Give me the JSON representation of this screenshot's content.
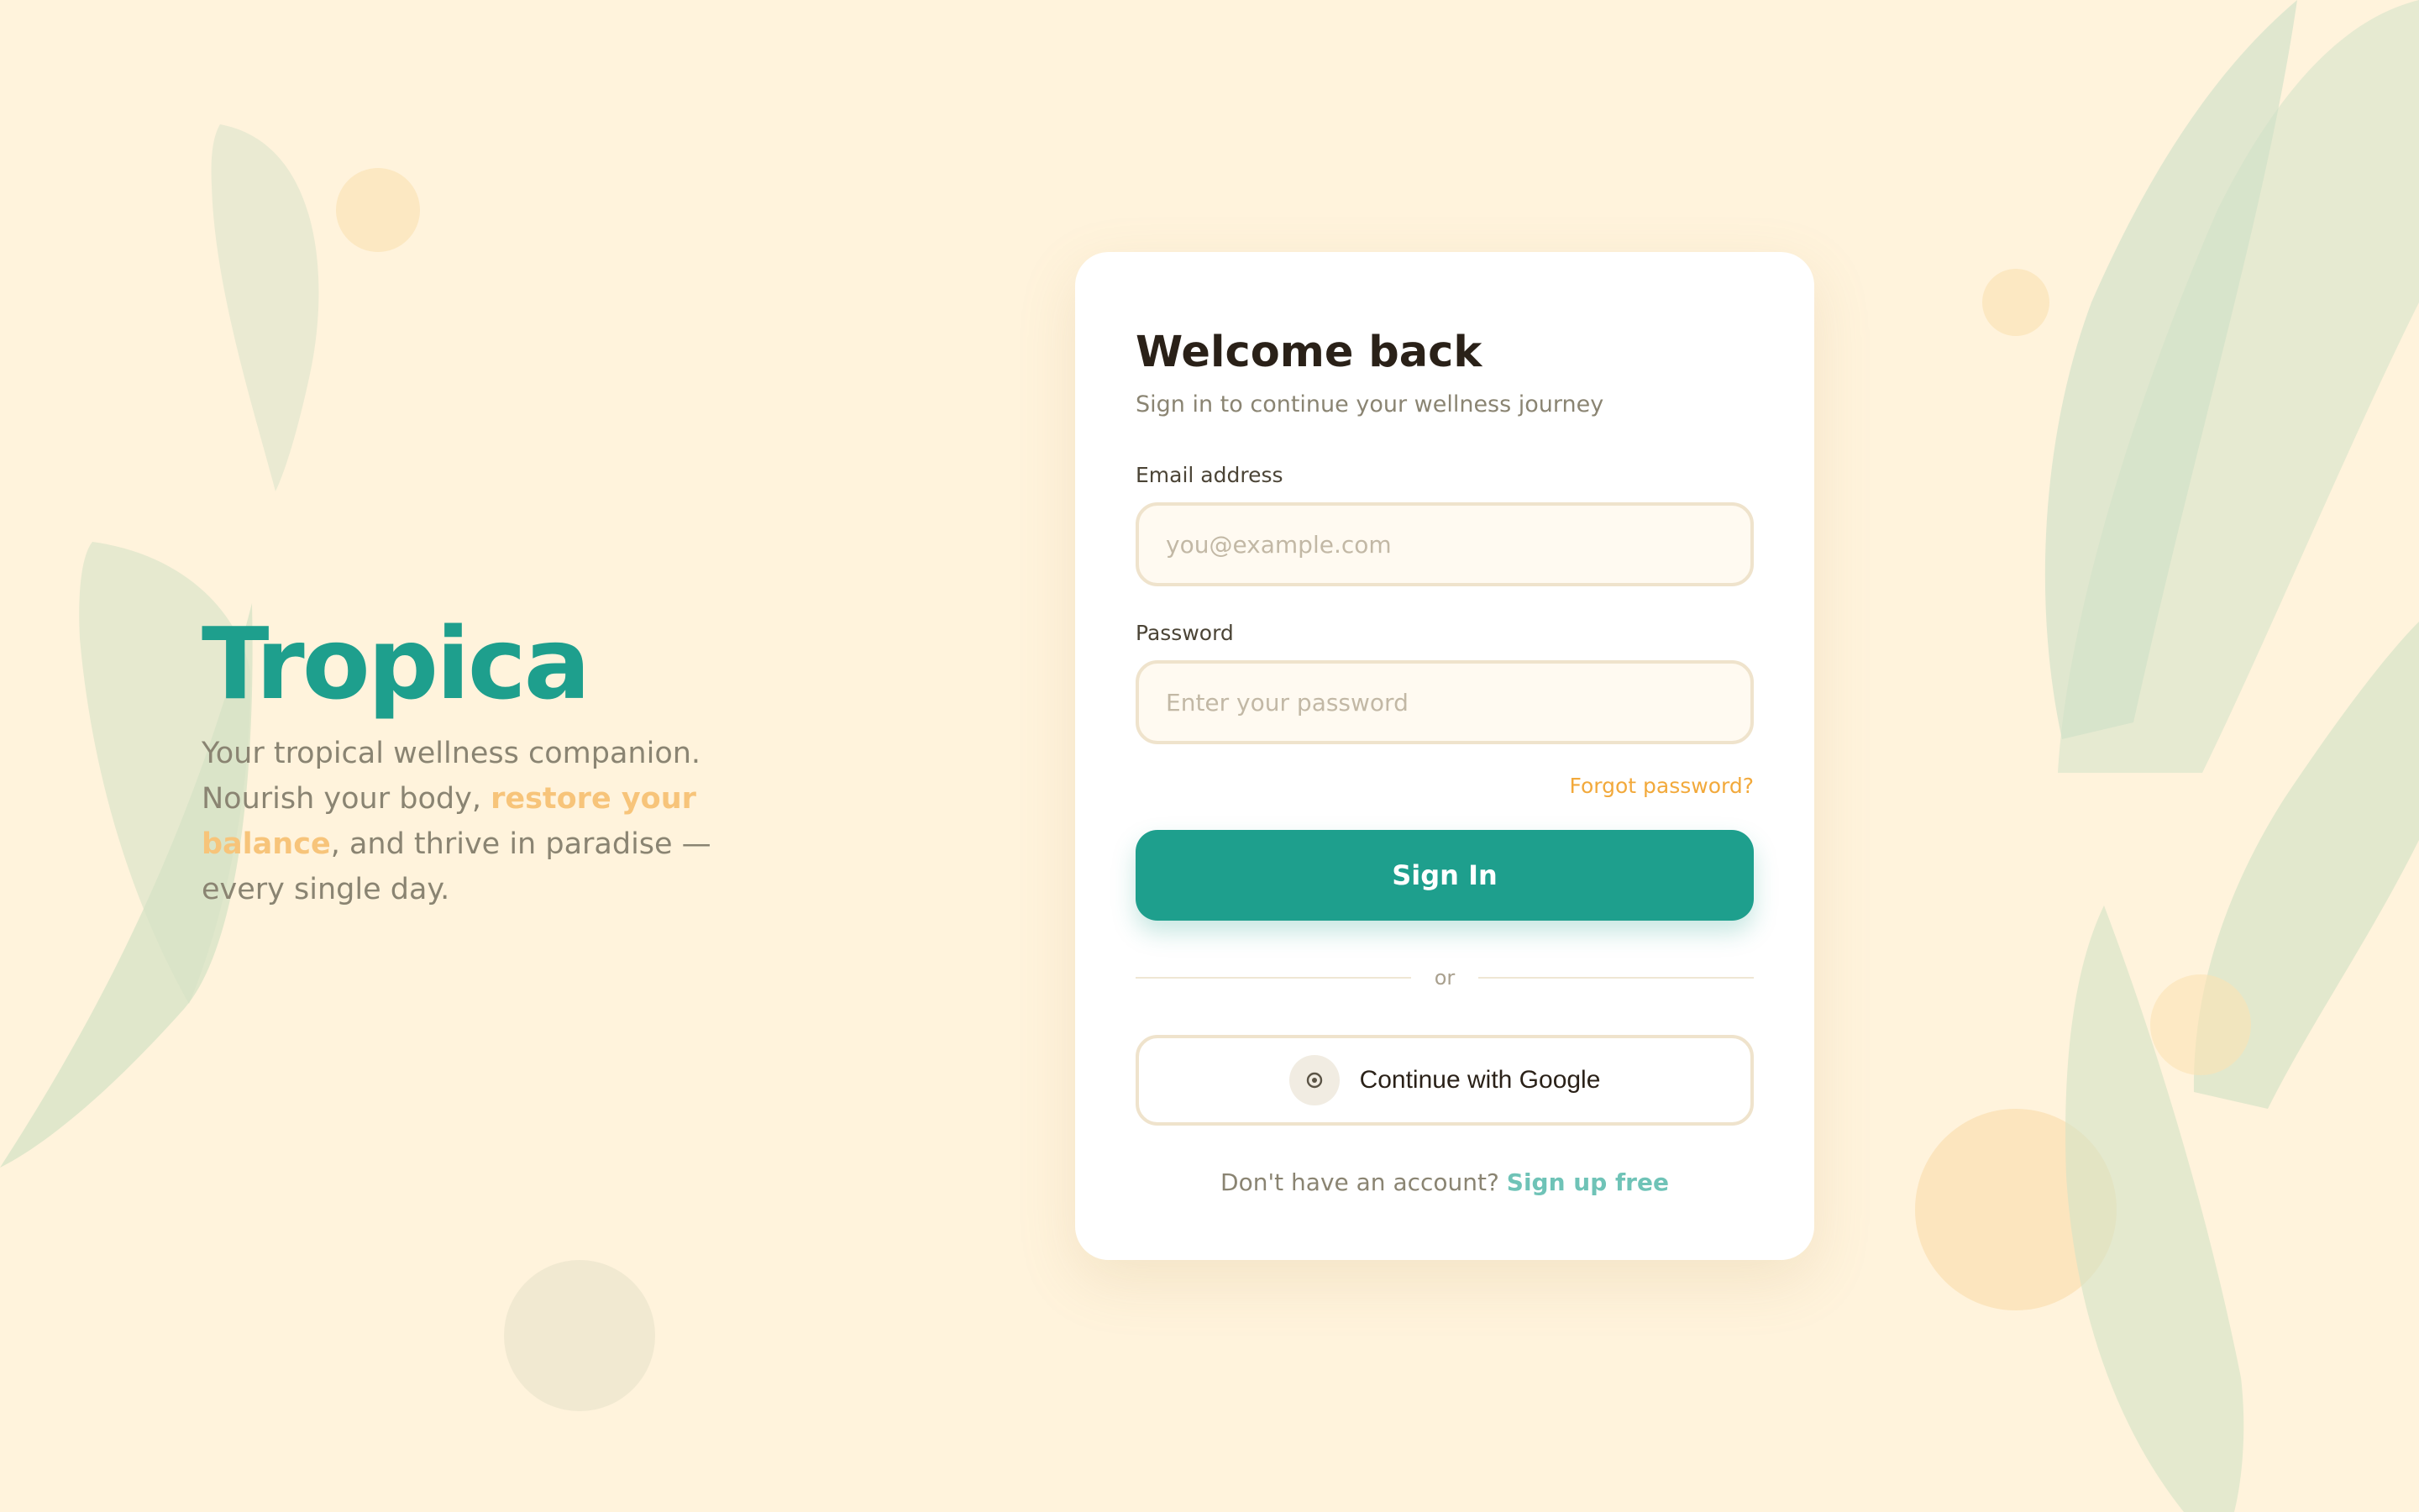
{
  "brand": {
    "name": "Tropica",
    "tagline_before": "Your tropical wellness companion. Nourish your body, ",
    "tagline_highlight": "restore your balance",
    "tagline_after": ", and thrive in paradise — every single day."
  },
  "login": {
    "title": "Welcome back",
    "subtitle": "Sign in to continue your wellness journey",
    "email_label": "Email address",
    "email_placeholder": "you@example.com",
    "email_value": "",
    "password_label": "Password",
    "password_placeholder": "Enter your password",
    "password_value": "",
    "forgot_label": "Forgot password?",
    "signin_label": "Sign In",
    "divider_label": "or",
    "google_label": "Continue with Google",
    "google_icon": "circle-dot-icon",
    "signup_prompt": "Don't have an account?",
    "signup_label": "Sign up free"
  },
  "colors": {
    "background": "#FFF3DC",
    "primary": "#1E9F8D",
    "accent": "#F2A93B",
    "highlight": "#F7C47A",
    "link": "#6FC3B7",
    "text_dark": "#2A2118",
    "text_muted": "#8A8472"
  }
}
